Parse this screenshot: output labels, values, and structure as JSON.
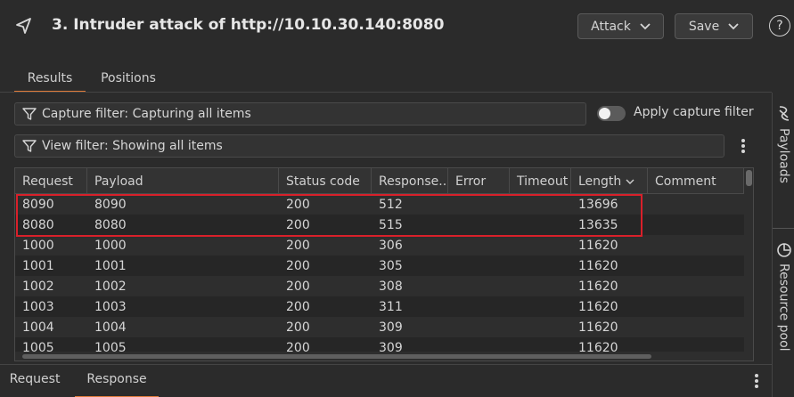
{
  "header": {
    "title": "3. Intruder attack of http://10.10.30.140:8080",
    "attack_label": "Attack",
    "save_label": "Save",
    "help_label": "?"
  },
  "tabs": [
    {
      "label": "Results",
      "active": true
    },
    {
      "label": "Positions",
      "active": false
    }
  ],
  "filters": {
    "capture_filter": "Capture filter: Capturing all items",
    "view_filter": "View filter: Showing all items",
    "apply_capture_filter_label": "Apply capture filter",
    "apply_capture_filter_on": false
  },
  "right_rail": {
    "payloads_label": "Payloads",
    "resource_pool_label": "Resource pool"
  },
  "table": {
    "columns": [
      "Request",
      "Payload",
      "Status code",
      "Response...",
      "Error",
      "Timeout",
      "Length",
      "Comment"
    ],
    "sorted_column": "Length",
    "rows": [
      [
        "8090",
        "8090",
        "200",
        "512",
        "",
        "",
        "13696",
        ""
      ],
      [
        "8080",
        "8080",
        "200",
        "515",
        "",
        "",
        "13635",
        ""
      ],
      [
        "1000",
        "1000",
        "200",
        "306",
        "",
        "",
        "11620",
        ""
      ],
      [
        "1001",
        "1001",
        "200",
        "305",
        "",
        "",
        "11620",
        ""
      ],
      [
        "1002",
        "1002",
        "200",
        "308",
        "",
        "",
        "11620",
        ""
      ],
      [
        "1003",
        "1003",
        "200",
        "311",
        "",
        "",
        "11620",
        ""
      ],
      [
        "1004",
        "1004",
        "200",
        "309",
        "",
        "",
        "11620",
        ""
      ],
      [
        "1005",
        "1005",
        "200",
        "309",
        "",
        "",
        "11620",
        ""
      ]
    ]
  },
  "bottom_tabs": [
    {
      "label": "Request",
      "active": false
    },
    {
      "label": "Response",
      "active": true
    }
  ],
  "colors": {
    "accent": "#e07b39",
    "highlight": "#d9202a",
    "background": "#2b2b2b"
  },
  "icons": [
    "back-icon",
    "chevron-down-icon",
    "help-icon",
    "filter-icon",
    "kebab-menu-icon",
    "payloads-icon",
    "resource-pool-icon",
    "sort-down-icon"
  ]
}
